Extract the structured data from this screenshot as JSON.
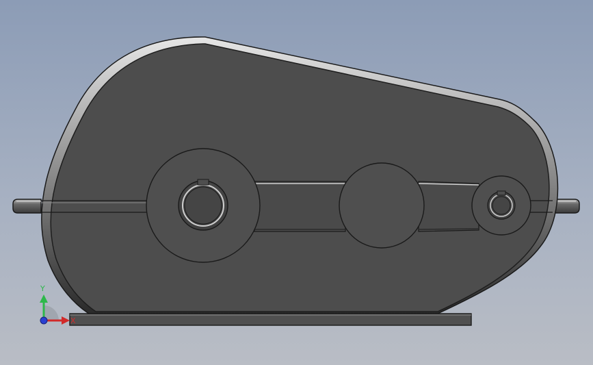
{
  "viewport": {
    "background_top": "#8c9cb6",
    "background_bottom": "#b9bdc5"
  },
  "model": {
    "body_color": "#4d4d4d",
    "edge_color": "#1a1a1a",
    "highlight_color": "#d8d8d8"
  },
  "triad": {
    "y_label": "Y",
    "x_label": "X",
    "y_color": "#2db84a",
    "x_color": "#d12a2a",
    "z_color": "#2a3fd1"
  }
}
